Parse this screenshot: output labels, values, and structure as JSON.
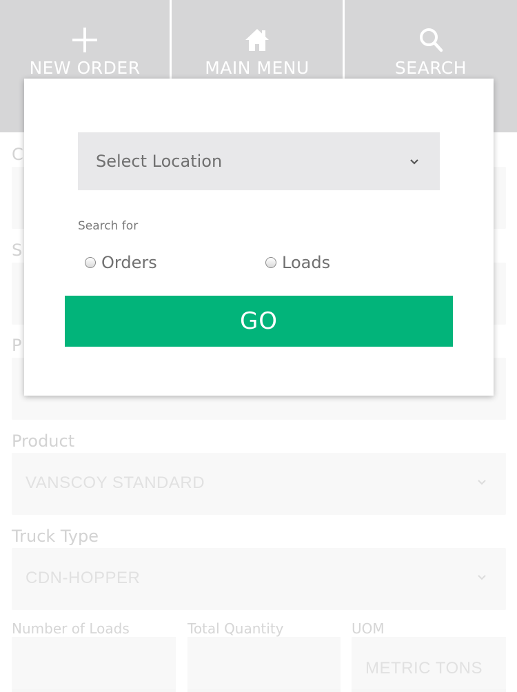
{
  "nav": {
    "new_order": "NEW ORDER",
    "main_menu": "MAIN MENU",
    "search": "SEARCH"
  },
  "form": {
    "partial_labels": [
      "C",
      "S",
      "P"
    ],
    "product_label": "Product",
    "product_value": "VANSCOY STANDARD",
    "truck_type_label": "Truck Type",
    "truck_type_value": "CDN-HOPPER",
    "number_of_loads_label": "Number of Loads",
    "total_quantity_label": "Total Quantity",
    "uom_label": "UOM",
    "uom_value": "METRIC TONS"
  },
  "modal": {
    "location_placeholder": "Select Location",
    "search_for_label": "Search for",
    "options": [
      "Orders",
      "Loads"
    ],
    "go_label": "GO"
  },
  "colors": {
    "nav_background": "#c8c8ca",
    "go_button": "#02b47a",
    "select_background": "#e8e8ea"
  },
  "icons": {
    "new_order": "plus-icon",
    "main_menu": "home-icon",
    "search": "search-icon"
  }
}
